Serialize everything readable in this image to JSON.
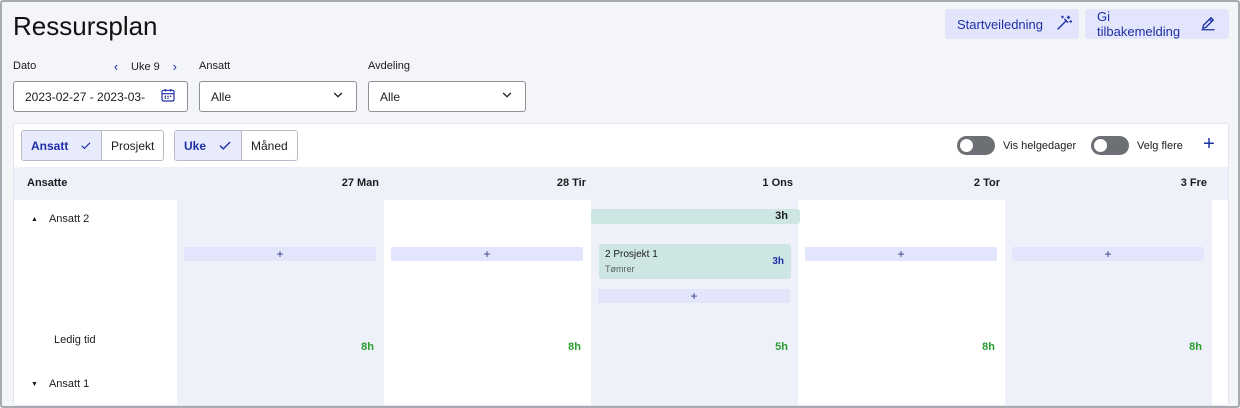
{
  "header": {
    "title": "Ressursplan",
    "guide_label": "Startveiledning",
    "feedback_label": "Gi tilbakemelding"
  },
  "filters": {
    "date_label": "Dato",
    "week_label": "Uke 9",
    "date_value": "2023-02-27 - 2023-03-",
    "employee_label": "Ansatt",
    "employee_value": "Alle",
    "department_label": "Avdeling",
    "department_value": "Alle"
  },
  "toolbar": {
    "view_options": [
      "Ansatt",
      "Prosjekt"
    ],
    "view_selected": "Ansatt",
    "period_options": [
      "Uke",
      "Måned"
    ],
    "period_selected": "Uke",
    "weekend_label": "Vis helgedager",
    "multi_label": "Velg flere",
    "add_symbol": "+"
  },
  "grid": {
    "first_col_header": "Ansatte",
    "days": [
      "27 Man",
      "28 Tir",
      "1 Ons",
      "2 Tor",
      "3 Fre"
    ],
    "add_symbol": "+",
    "rows": {
      "employee_2": {
        "name": "Ansatt 2",
        "free_label": "Ledig tid",
        "free_hours": [
          "8h",
          "8h",
          "5h",
          "8h",
          "8h"
        ],
        "day_total": "3h",
        "task": {
          "project": "2 Prosjekt 1",
          "role": "Tømrer",
          "hours": "3h"
        }
      },
      "employee_1": {
        "name": "Ansatt 1"
      }
    }
  },
  "colors": {
    "accent": "#1f2fa6",
    "add_bar": "#e2e5fb",
    "task_bg": "#cde6e3",
    "free_hours": "#2a9d2f",
    "toggle_off": "#6c6f74"
  }
}
